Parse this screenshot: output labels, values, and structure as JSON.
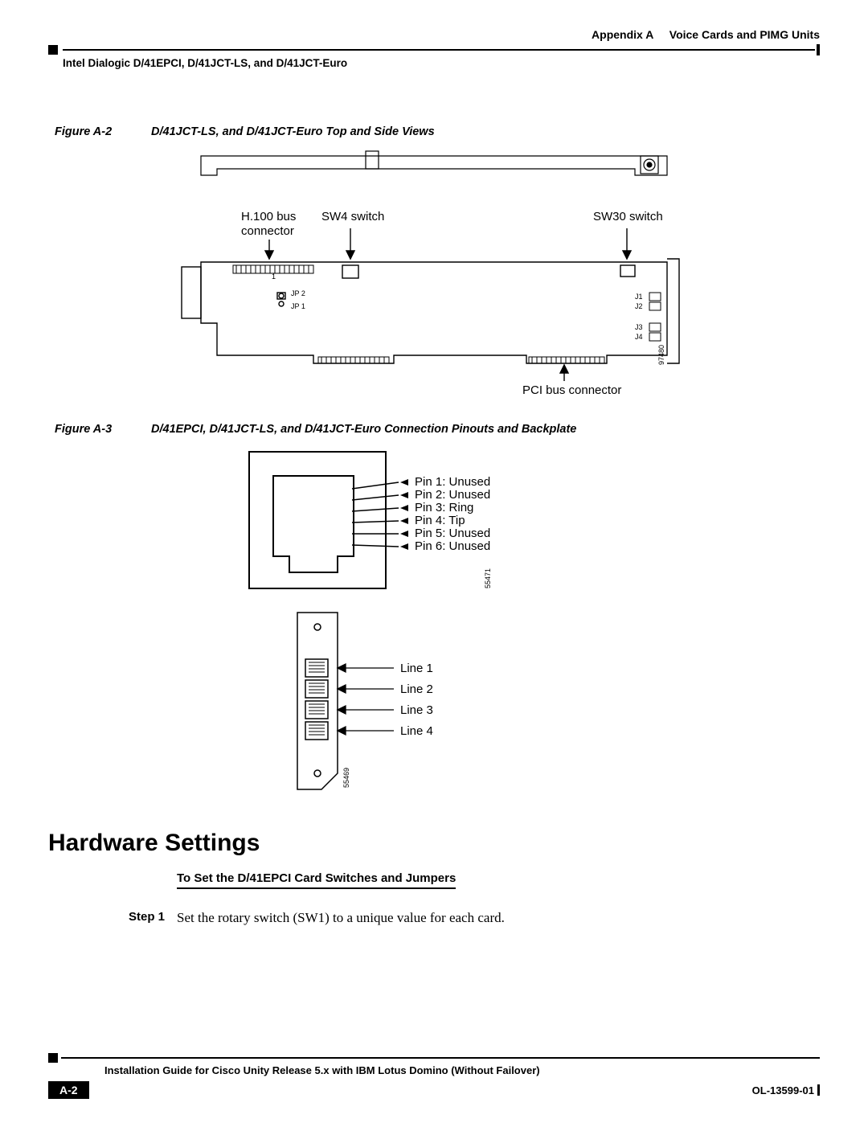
{
  "header": {
    "appendix_label": "Appendix A",
    "appendix_title": "Voice Cards and PIMG Units",
    "section_title": "Intel Dialogic D/41EPCI, D/41JCT-LS, and D/41JCT-Euro"
  },
  "figures": {
    "a2": {
      "num": "Figure A-2",
      "caption": "D/41JCT-LS, and D/41JCT-Euro Top and Side Views",
      "labels": {
        "h100_line1": "H.100 bus",
        "h100_line2": "connector",
        "sw4": "SW4 switch",
        "sw30": "SW30 switch",
        "pci": "PCI bus connector",
        "jp2": "JP 2",
        "jp1": "JP 1",
        "j1": "J1",
        "j2": "J2",
        "j3": "J3",
        "j4": "J4",
        "one": "1",
        "img_id": "97480"
      }
    },
    "a3": {
      "num": "Figure A-3",
      "caption": "D/41EPCI, D/41JCT-LS, and D/41JCT-Euro Connection Pinouts and Backplate",
      "pins": {
        "p1": "Pin 1: Unused",
        "p2": "Pin 2: Unused",
        "p3": "Pin 3: Ring",
        "p4": "Pin 4: Tip",
        "p5": "Pin 5: Unused",
        "p6": "Pin 6: Unused",
        "pin_img_id": "55471"
      },
      "lines": {
        "l1": "Line 1",
        "l2": "Line 2",
        "l3": "Line 3",
        "l4": "Line 4",
        "bp_img_id": "55469"
      }
    }
  },
  "h1": "Hardware Settings",
  "h2": "To Set the D/41EPCI Card Switches and Jumpers",
  "step1": {
    "label": "Step 1",
    "text": "Set the rotary switch (SW1) to a unique value for each card."
  },
  "footer": {
    "guide": "Installation Guide for Cisco Unity Release 5.x with IBM Lotus Domino (Without Failover)",
    "page": "A-2",
    "doc_id": "OL-13599-01"
  }
}
